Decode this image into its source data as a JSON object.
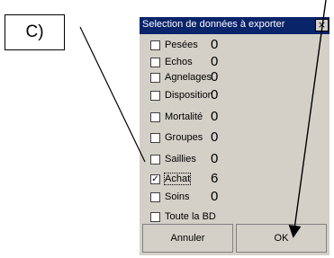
{
  "callout": {
    "label": "C)"
  },
  "dialog": {
    "title": "Selection de données à exporter",
    "close_glyph": "×",
    "items": [
      {
        "label": "Pesées",
        "value": "0",
        "checked": false
      },
      {
        "label": "Echos",
        "value": "0",
        "checked": false
      },
      {
        "label": "Agnelages",
        "value": "0",
        "checked": false
      },
      {
        "label": "Disposition",
        "value": "0",
        "checked": false
      },
      {
        "label": "Mortalité",
        "value": "0",
        "checked": false
      },
      {
        "label": "Groupes",
        "value": "0",
        "checked": false
      },
      {
        "label": "Saillies",
        "value": "0",
        "checked": false
      },
      {
        "label": "Achat",
        "value": "6",
        "checked": true
      },
      {
        "label": "Soins",
        "value": "0",
        "checked": false
      },
      {
        "label": "Toute la BD",
        "value": "",
        "checked": false
      }
    ],
    "cancel_label": "Annuler",
    "ok_label": "OK"
  }
}
